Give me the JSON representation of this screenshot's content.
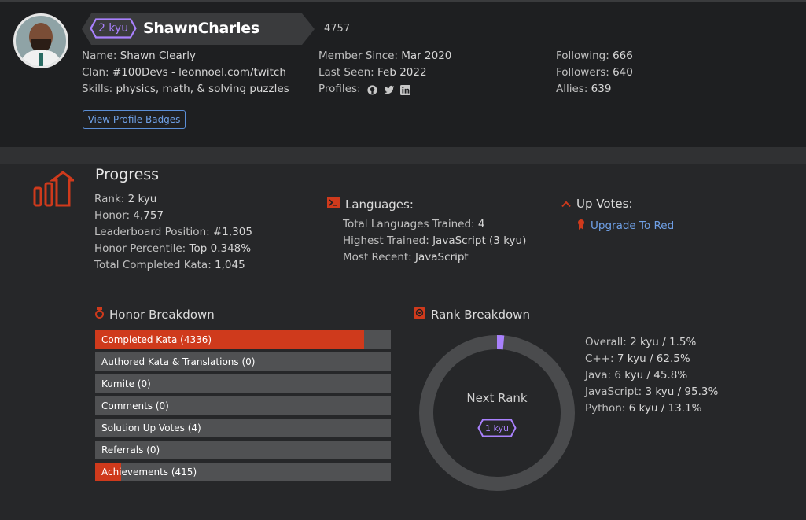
{
  "profile": {
    "rank_badge": "2 kyu",
    "username": "ShawnCharles",
    "honor": "4757",
    "col1": [
      {
        "label": "Name:",
        "value": "Shawn Clearly"
      },
      {
        "label": "Clan:",
        "value": "#100Devs - leonnoel.com/twitch"
      },
      {
        "label": "Skills:",
        "value": "physics, math, & solving puzzles"
      }
    ],
    "col2": [
      {
        "label": "Member Since:",
        "value": "Mar 2020"
      },
      {
        "label": "Last Seen:",
        "value": "Feb 2022"
      }
    ],
    "profiles_label": "Profiles:",
    "profile_icons": [
      "github-icon",
      "twitter-icon",
      "linkedin-icon"
    ],
    "col3": [
      {
        "label": "Following:",
        "value": "666"
      },
      {
        "label": "Followers:",
        "value": "640"
      },
      {
        "label": "Allies:",
        "value": "639"
      }
    ],
    "view_badges_button": "View Profile Badges"
  },
  "progress": {
    "title": "Progress",
    "stats": [
      {
        "label": "Rank:",
        "value": "2 kyu"
      },
      {
        "label": "Honor:",
        "value": "4,757"
      },
      {
        "label": "Leaderboard Position:",
        "value": "#1,305"
      },
      {
        "label": "Honor Percentile:",
        "value": "Top 0.348%"
      },
      {
        "label": "Total Completed Kata:",
        "value": "1,045"
      }
    ],
    "languages_title": "Languages:",
    "languages": [
      {
        "label": "Total Languages Trained:",
        "value": "4"
      },
      {
        "label": "Highest Trained:",
        "value": "JavaScript (3 kyu)"
      },
      {
        "label": "Most Recent:",
        "value": "JavaScript"
      }
    ],
    "upvotes_title": "Up Votes:",
    "upvotes_link": "Upgrade To Red"
  },
  "honor_breakdown": {
    "title": "Honor Breakdown",
    "items": [
      {
        "label": "Completed Kata (4336)",
        "fraction": 0.91
      },
      {
        "label": "Authored Kata & Translations (0)",
        "fraction": 0
      },
      {
        "label": "Kumite (0)",
        "fraction": 0
      },
      {
        "label": "Comments (0)",
        "fraction": 0
      },
      {
        "label": "Solution Up Votes (4)",
        "fraction": 0
      },
      {
        "label": "Referrals (0)",
        "fraction": 0
      },
      {
        "label": "Achievements (415)",
        "fraction": 0.087
      }
    ]
  },
  "rank_breakdown": {
    "title": "Rank Breakdown",
    "next_rank_label": "Next Rank",
    "next_rank_badge": "1 kyu",
    "overall_progress_percent": 1.5,
    "entries": [
      {
        "label": "Overall:",
        "value": "2 kyu / 1.5%"
      },
      {
        "label": "C++:",
        "value": "7 kyu / 62.5%"
      },
      {
        "label": "Java:",
        "value": "6 kyu / 45.8%"
      },
      {
        "label": "JavaScript:",
        "value": "3 kyu / 95.3%"
      },
      {
        "label": "Python:",
        "value": "6 kyu / 13.1%"
      }
    ]
  },
  "colors": {
    "accent_red": "#cf3a1c",
    "kyu_purple": "#a981fd",
    "link_blue": "#6fa0e6"
  }
}
